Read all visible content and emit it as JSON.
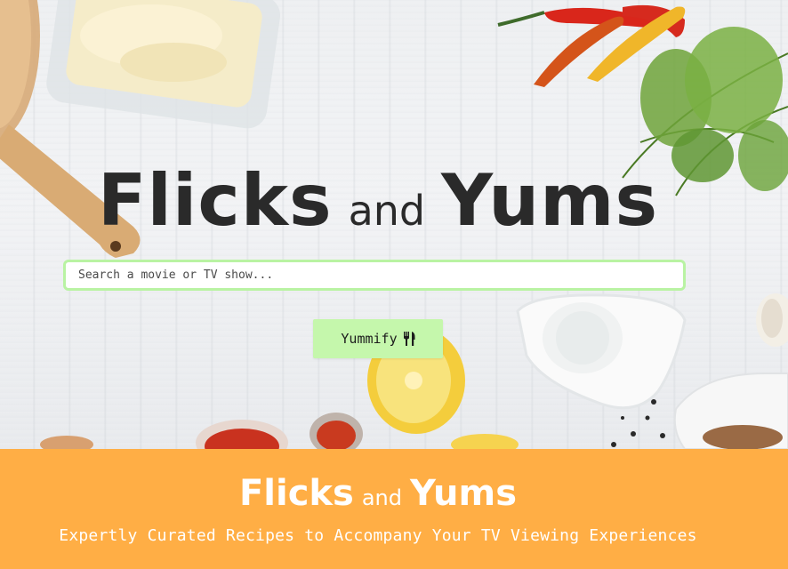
{
  "hero": {
    "title_part1": "Flicks",
    "title_connector": "and",
    "title_part2": "Yums"
  },
  "search": {
    "placeholder": "Search a movie or TV show...",
    "value": ""
  },
  "button": {
    "label": "Yummify",
    "icon": "fork-knife-icon"
  },
  "footer": {
    "title_part1": "Flicks",
    "title_connector": "and",
    "title_part2": "Yums",
    "tagline": "Expertly Curated Recipes to Accompany Your TV Viewing Experiences"
  },
  "colors": {
    "title_text": "#2a2a2a",
    "search_border": "#b9f3a3",
    "button_bg": "#c5f7ac",
    "footer_bg": "#ffae45",
    "footer_text": "#ffffff"
  }
}
